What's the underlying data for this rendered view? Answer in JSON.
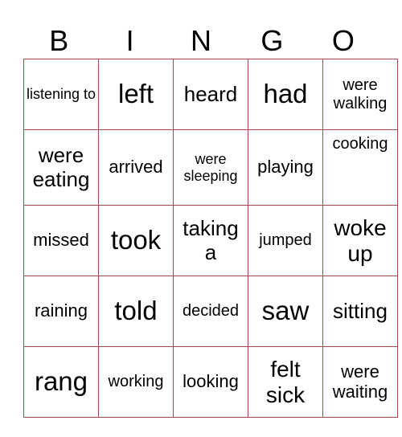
{
  "header": {
    "letters": [
      "B",
      "I",
      "N",
      "G",
      "O"
    ]
  },
  "grid": {
    "rows": [
      [
        "listening to",
        "left",
        "heard",
        "had",
        "were walking"
      ],
      [
        "were eating",
        "arrived",
        "were sleeping",
        "playing",
        "cooking"
      ],
      [
        "missed",
        "took",
        "taking a",
        "jumped",
        "woke up"
      ],
      [
        "raining",
        "told",
        "decided",
        "saw",
        "sitting"
      ],
      [
        "rang",
        "working",
        "looking",
        "felt sick",
        "were waiting"
      ]
    ]
  },
  "colors": {
    "grid_border": "#a8474f"
  }
}
